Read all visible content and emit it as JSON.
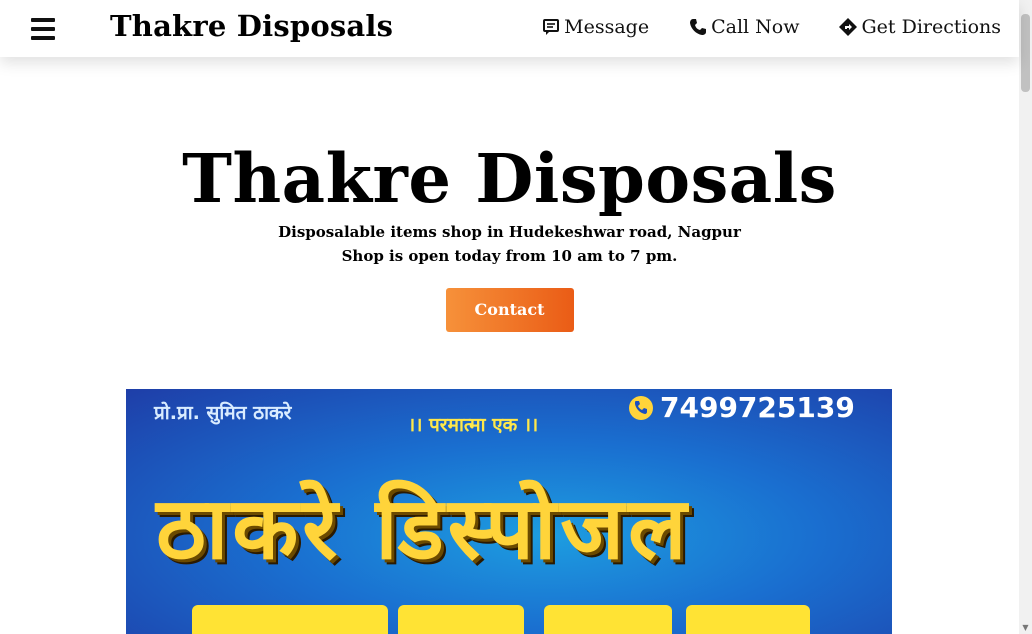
{
  "navbar": {
    "brand": "Thakre Disposals",
    "links": [
      {
        "label": "Message",
        "icon": "message-icon"
      },
      {
        "label": "Call Now",
        "icon": "phone-icon"
      },
      {
        "label": "Get Directions",
        "icon": "directions-icon"
      }
    ]
  },
  "hero": {
    "title": "Thakre Disposals",
    "subtitle_line1": "Disposalable items shop in Hudekeshwar road, Nagpur",
    "subtitle_line2": "Shop is open today from 10 am to 7 pm.",
    "contact_label": "Contact"
  },
  "banner": {
    "top_left_text": "प्रो.प्रा. सुमित ठाकरे",
    "middle_text": "।। परमात्मा एक ।।",
    "phone": "7499725139",
    "big_text": "ठाकरे डिस्पोजल"
  },
  "colors": {
    "contact_gradient_start": "#f6913a",
    "contact_gradient_end": "#ea5c16",
    "banner_blue": "#1a6fd0",
    "banner_yellow": "#ffd43a"
  }
}
